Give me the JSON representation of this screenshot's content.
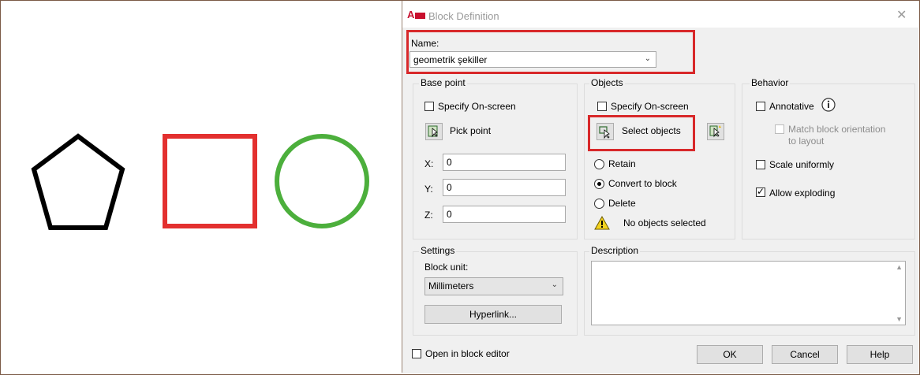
{
  "dialog": {
    "title": "Block Definition",
    "app_icon_text": "A",
    "close_glyph": "✕"
  },
  "name": {
    "label": "Name:",
    "value": "geometrik şekiller"
  },
  "base_point": {
    "group_label": "Base point",
    "specify_label": "Specify On-screen",
    "pick_point_label": "Pick point",
    "x_label": "X:",
    "x_value": "0",
    "y_label": "Y:",
    "y_value": "0",
    "z_label": "Z:",
    "z_value": "0"
  },
  "objects": {
    "group_label": "Objects",
    "specify_label": "Specify On-screen",
    "select_objects_label": "Select objects",
    "retain_label": "Retain",
    "convert_label": "Convert to block",
    "delete_label": "Delete",
    "status_text": "No objects selected"
  },
  "behavior": {
    "group_label": "Behavior",
    "annotative_label": "Annotative",
    "match_orientation_label_1": "Match block orientation",
    "match_orientation_label_2": "to layout",
    "scale_uniformly_label": "Scale uniformly",
    "allow_exploding_label": "Allow exploding",
    "annotative_checked": false,
    "scale_uniformly_checked": false,
    "allow_exploding_checked": true
  },
  "settings": {
    "group_label": "Settings",
    "block_unit_label": "Block unit:",
    "block_unit_value": "Millimeters",
    "hyperlink_label": "Hyperlink..."
  },
  "description": {
    "group_label": "Description",
    "value": ""
  },
  "footer": {
    "open_in_editor_label": "Open in block editor",
    "ok_label": "OK",
    "cancel_label": "Cancel",
    "help_label": "Help"
  },
  "colors": {
    "highlight_red": "#d8282a",
    "square_red": "#e3302f",
    "circle_green": "#4caf3c",
    "pentagon_black": "#000000"
  }
}
